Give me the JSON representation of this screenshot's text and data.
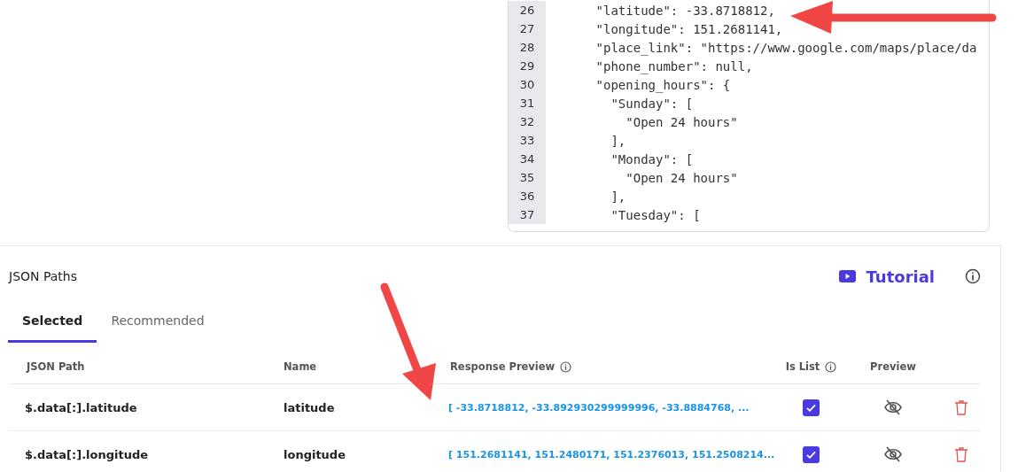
{
  "code_viewer": {
    "lines": [
      {
        "number": "26",
        "text": "      \"latitude\": -33.8718812,"
      },
      {
        "number": "27",
        "text": "      \"longitude\": 151.2681141,"
      },
      {
        "number": "28",
        "text": "      \"place_link\": \"https://www.google.com/maps/place/da"
      },
      {
        "number": "29",
        "text": "      \"phone_number\": null,"
      },
      {
        "number": "30",
        "text": "      \"opening_hours\": {"
      },
      {
        "number": "31",
        "text": "        \"Sunday\": ["
      },
      {
        "number": "32",
        "text": "          \"Open 24 hours\""
      },
      {
        "number": "33",
        "text": "        ],"
      },
      {
        "number": "34",
        "text": "        \"Monday\": ["
      },
      {
        "number": "35",
        "text": "          \"Open 24 hours\""
      },
      {
        "number": "36",
        "text": "        ],"
      },
      {
        "number": "37",
        "text": "        \"Tuesday\": ["
      }
    ]
  },
  "json_paths": {
    "title": "JSON Paths",
    "tutorial": "Tutorial",
    "tabs": [
      {
        "label": "Selected",
        "selected": true
      },
      {
        "label": "Recommended",
        "selected": false
      }
    ],
    "columns": [
      "JSON Path",
      "Name",
      "Response Preview",
      "Is List",
      "Preview"
    ],
    "rows": [
      {
        "path": "$.data[:].latitude",
        "name": "latitude",
        "preview": "[ -33.8718812, -33.892930299999996, -33.8884768, ...",
        "is_list": true
      },
      {
        "path": "$.data[:].longitude",
        "name": "longitude",
        "preview": "[ 151.2681141, 151.2480171, 151.2376013, 151.2508214...",
        "is_list": true
      }
    ]
  }
}
